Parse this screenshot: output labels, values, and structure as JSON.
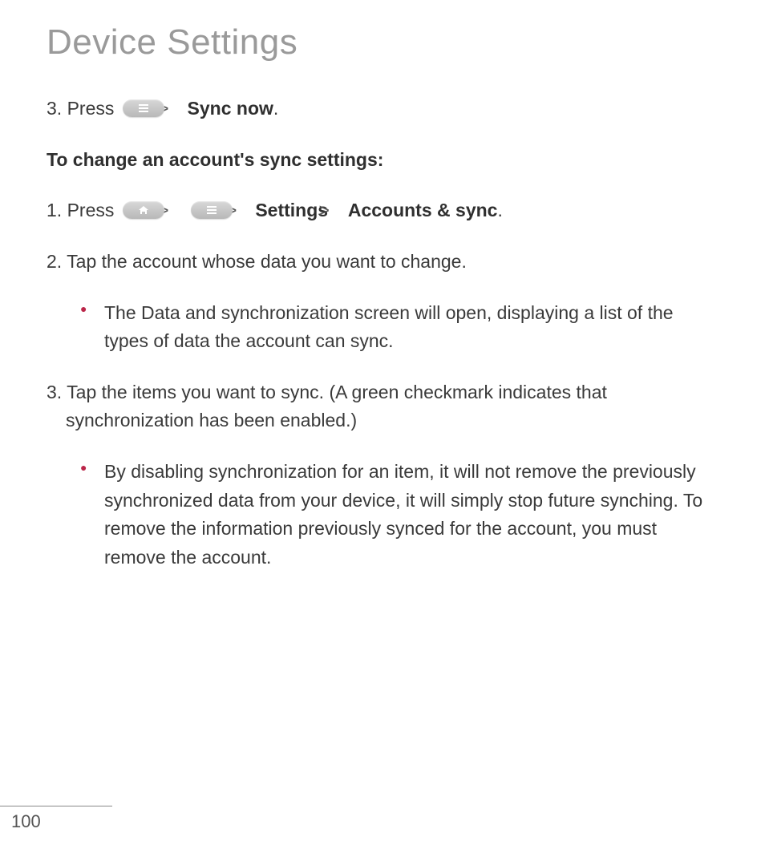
{
  "title": "Device Settings",
  "step_a": {
    "num": "3.",
    "lead": "Press ",
    "chevron": ">",
    "bold": "Sync now",
    "period": "."
  },
  "subhead": "To change an account's sync settings:",
  "step1": {
    "num": "1.",
    "lead": "Press ",
    "chevron1": ">",
    "chevron2": ">",
    "settings": "Settings",
    "chevron3": ">",
    "accounts": "Accounts & sync",
    "period": "."
  },
  "step2": {
    "num": "2.",
    "text": "Tap the account whose data you want to change."
  },
  "bullet1": "The Data and synchronization screen will open, displaying a list of the types of data the account can sync.",
  "step3": {
    "num": "3.",
    "text": "Tap the items you want to sync. (A green checkmark indicates that synchronization has been enabled.)"
  },
  "bullet2": "By disabling synchronization for an item, it will not remove the previously synchronized data from your device, it will simply stop future synching. To remove the information previously synced for the account, you must remove the account.",
  "page_number": "100",
  "icons": {
    "menu": "menu-button",
    "home": "home-button"
  }
}
